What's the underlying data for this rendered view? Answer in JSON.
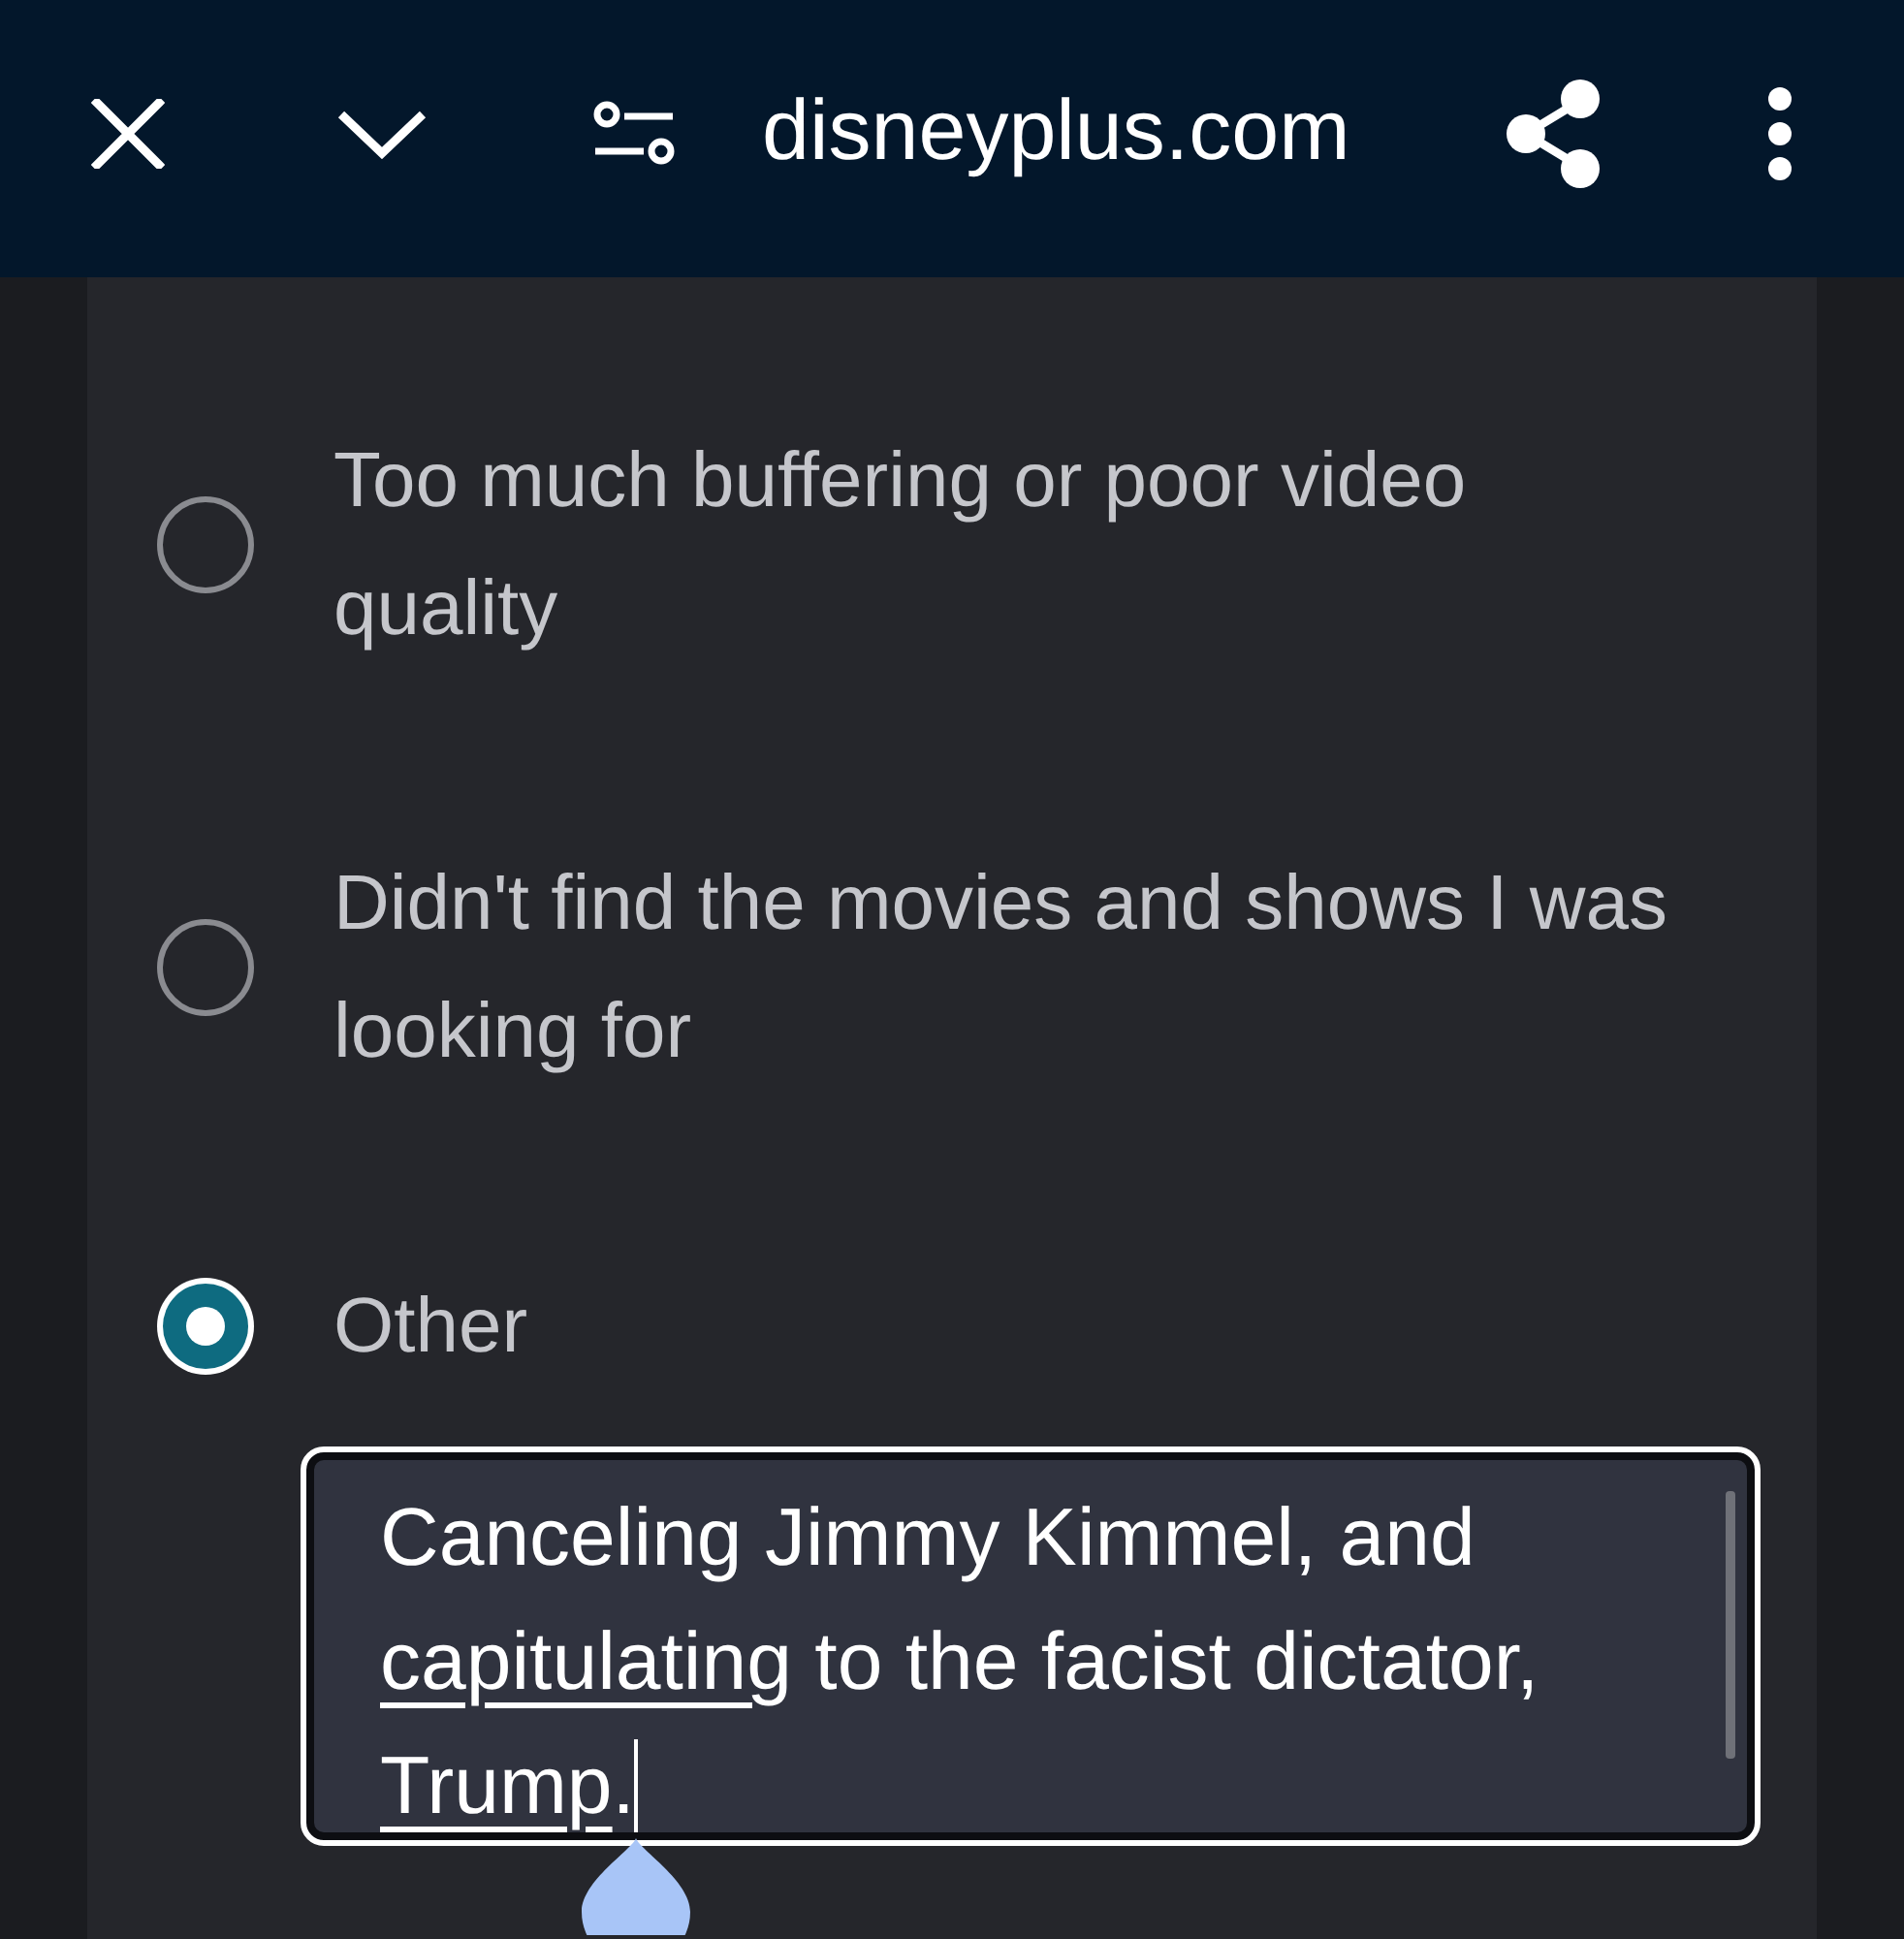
{
  "browser_bar": {
    "url": "disneyplus.com"
  },
  "options": [
    {
      "label": "Too much buffering or poor video quality",
      "selected": false
    },
    {
      "label": "Didn't find the movies and shows I was looking for",
      "selected": false
    },
    {
      "label": "Other",
      "selected": true
    }
  ],
  "other_field": {
    "focused": true,
    "value_segments": [
      {
        "text": "Canceling Jimmy Kimmel, and ",
        "underlined": false
      },
      {
        "text": "capitulating",
        "underlined": true
      },
      {
        "text": " to the facist dictator, ",
        "underlined": false
      },
      {
        "text": "Trump",
        "underlined": true
      },
      {
        "text": ".",
        "underlined": false
      }
    ]
  }
}
